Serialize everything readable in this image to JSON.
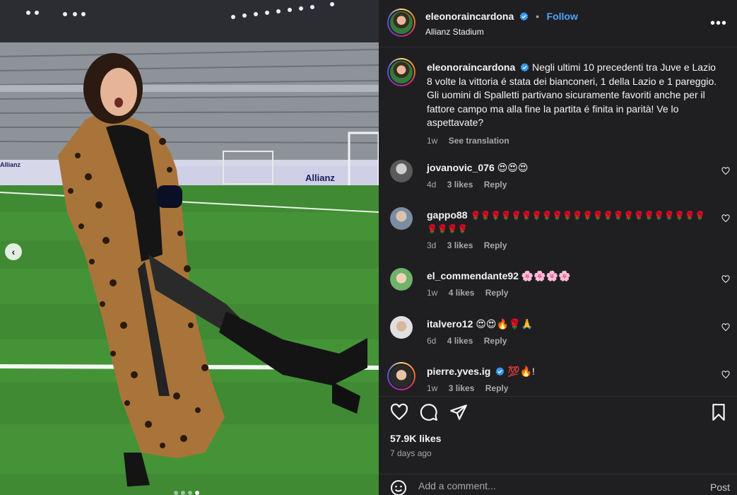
{
  "post": {
    "author": "eleonoraincardona",
    "follow_label": "Follow",
    "separator": "•",
    "location": "Allianz Stadium",
    "more_label": "•••",
    "caption": "Negli ultimi 10 precedenti tra Juve e Lazio 8 volte la vittoria é stata dei bianconeri, 1 della Lazio e 1 pareggio. Gli uomini di Spalletti partivano sicuramente favoriti anche per il fattore campo ma alla fine la partita é finita in parità! Ve lo aspettavate?",
    "caption_time": "1w",
    "translate_label": "See translation",
    "banners": [
      "Allianz",
      "Allianz"
    ]
  },
  "comments": [
    {
      "user": "jovanovic_076",
      "text": "😍😍😍",
      "time": "4d",
      "likes": "3 likes",
      "reply": "Reply"
    },
    {
      "user": "gappo88",
      "text": "🌹🌹🌹🌹🌹🌹🌹🌹🌹🌹🌹🌹🌹🌹🌹🌹🌹🌹🌹🌹🌹🌹🌹🌹🌹🌹🌹",
      "time": "3d",
      "likes": "3 likes",
      "reply": "Reply"
    },
    {
      "user": "el_commendante92",
      "text": "🌸🌸🌸🌸",
      "time": "1w",
      "likes": "4 likes",
      "reply": "Reply"
    },
    {
      "user": "italvero12",
      "text": "😍😍🔥🌹🙏",
      "time": "6d",
      "likes": "4 likes",
      "reply": "Reply"
    },
    {
      "user": "pierre.yves.ig",
      "text": "💯🔥!",
      "time": "1w",
      "likes": "3 likes",
      "reply": "Reply"
    }
  ],
  "stats": {
    "likes": "57.9K likes",
    "posted": "7 days ago"
  },
  "composer": {
    "placeholder": "Add a comment...",
    "post_label": "Post"
  },
  "carousel": {
    "prev_label": "‹",
    "total": 4,
    "active": 2
  },
  "colors": {
    "accent": "#4ea2ff",
    "panel_bg": "#1f1f22",
    "muted_text": "#a8a8a8"
  },
  "icons": {
    "like": "heart-icon",
    "comment": "comment-icon",
    "share": "share-icon",
    "save": "bookmark-icon",
    "emoji": "emoji-icon",
    "verified": "verified-badge-icon"
  }
}
